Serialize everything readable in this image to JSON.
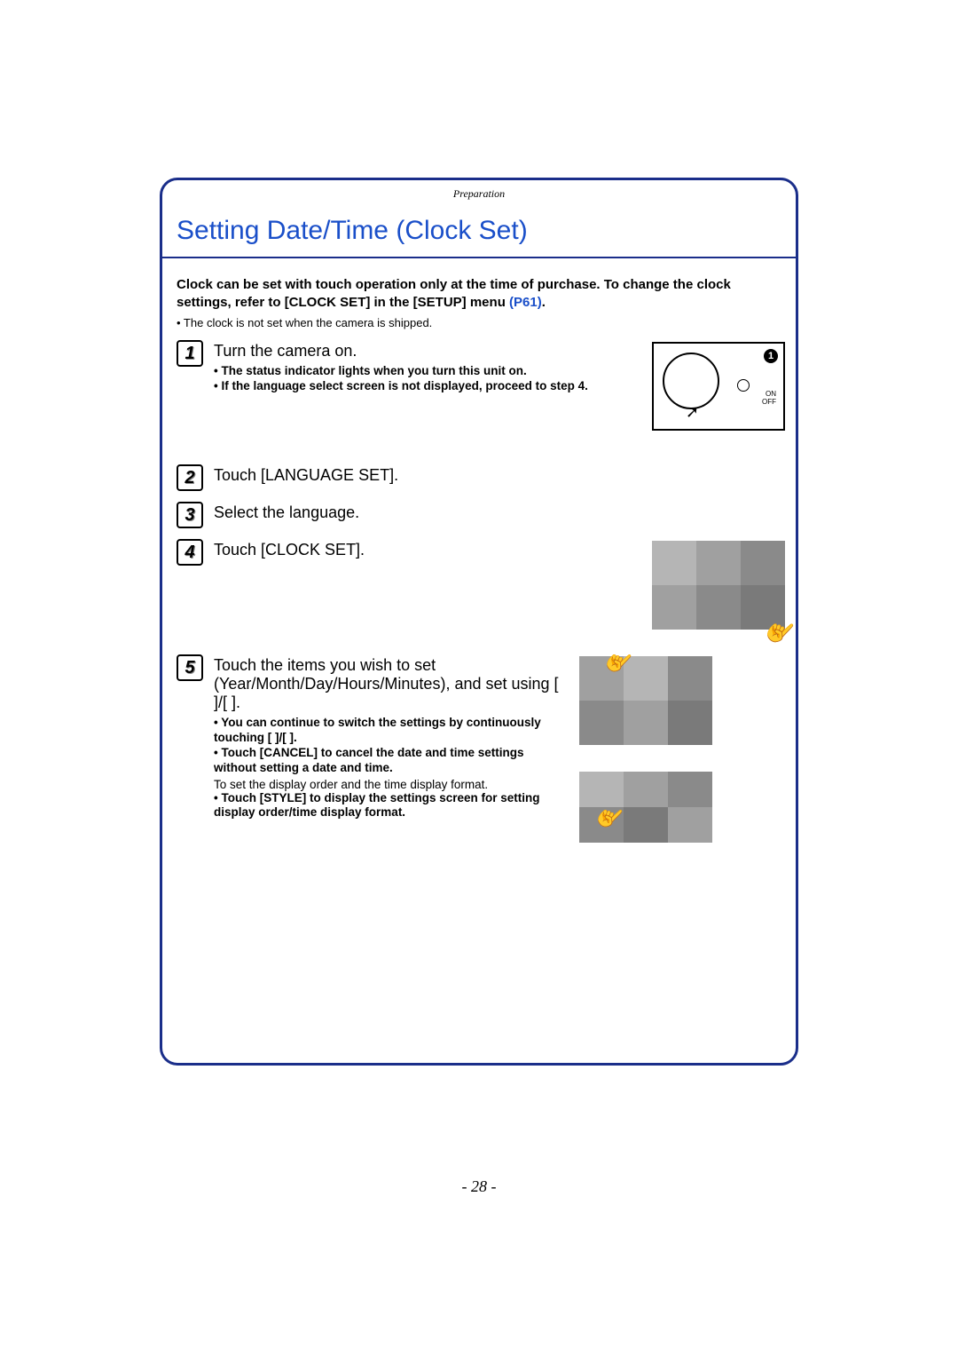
{
  "header": {
    "section": "Preparation"
  },
  "title": "Setting Date/Time (Clock Set)",
  "intro_part1": "Clock can be set with touch operation only at the time of purchase. To change the clock settings, refer to [CLOCK SET] in the [SETUP] menu ",
  "intro_link": "(P61)",
  "intro_part2": ".",
  "note": "• The clock is not set when the camera is shipped.",
  "steps": {
    "s1": {
      "num": "1",
      "title": "Turn the camera on.",
      "sub1": "• The status indicator   lights when you turn this unit on.",
      "sub2": "• If the language select screen is not displayed, proceed to step ",
      "sub2_ref": "4",
      "sub2_end": "."
    },
    "s2": {
      "num": "2",
      "title": "Touch [LANGUAGE SET]."
    },
    "s3": {
      "num": "3",
      "title": "Select the language."
    },
    "s4": {
      "num": "4",
      "title": "Touch [CLOCK SET]."
    },
    "s5": {
      "num": "5",
      "title": "Touch the items you wish to set (Year/Month/Day/Hours/Minutes), and set using [      ]/[   ].",
      "sub1": "• You can continue to switch the settings by continuously touching [  ]/[  ].",
      "sub2": "• Touch [CANCEL] to cancel the date and time settings without setting a date and time.",
      "plain": "To set the display order and the time display format.",
      "sub3": "• Touch [STYLE] to display the settings screen for setting display order/time display format."
    }
  },
  "figure": {
    "badge1": "1",
    "on_label": "ON",
    "off_label": "OFF"
  },
  "page_number": "- 28 -"
}
